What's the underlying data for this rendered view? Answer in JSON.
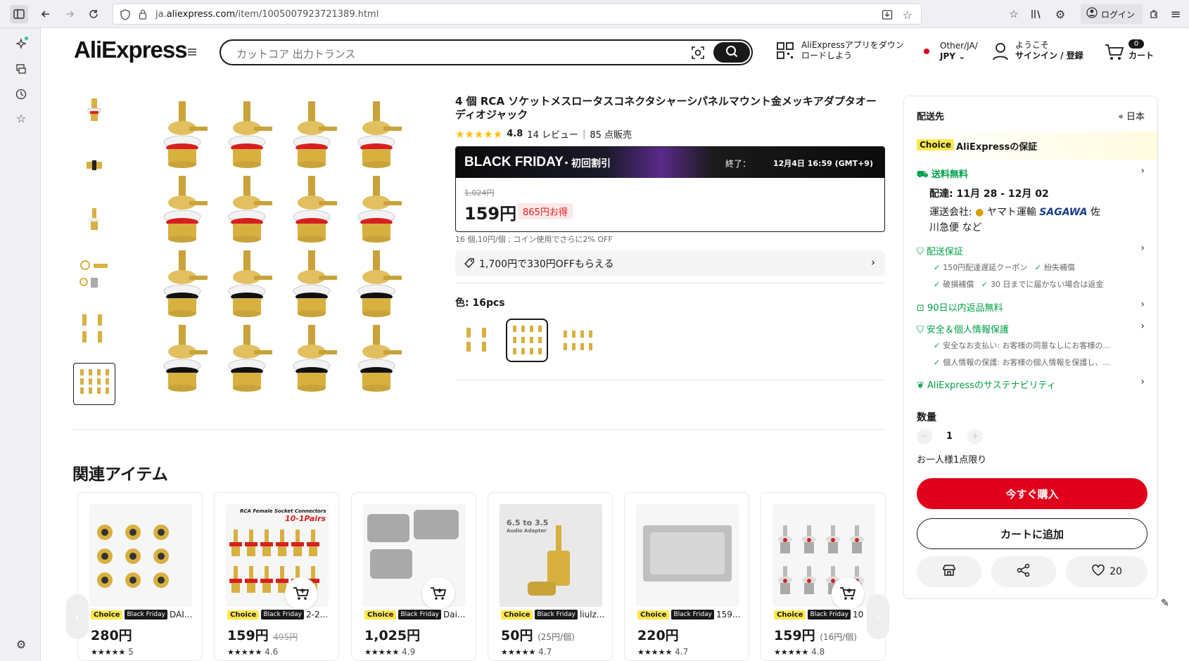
{
  "browser": {
    "url_prefix": "ja.",
    "url_domain": "aliexpress.com",
    "url_path": "/item/1005007923721389.html",
    "login_label": "ログイン"
  },
  "header": {
    "logo": "AliExpress",
    "search_placeholder": "カットコア 出力トランス",
    "app_line1": "AliExpressアプリをダウン",
    "app_line2": "ロードしよう",
    "region_line1": "Other/JA/",
    "region_line2": "JPY",
    "user_line1": "ようこそ",
    "user_line2": "サインイン / 登録",
    "cart_count": "0",
    "cart_label": "カート"
  },
  "product": {
    "title": "4 個 RCA ソケットメスロータスコネクタシャーシパネルマウント金メッキアダプタオーディオジャック",
    "rating": "4.8",
    "reviews": "14 レビュー",
    "sold": "85 点販売",
    "bf_title": "BLACK FRIDAY",
    "bf_sub": "・初回割引",
    "bf_end_label": "終了：",
    "bf_end_time": "12月4日 16:59 (GMT+9)",
    "price_old": "1,024円",
    "price": "159円",
    "save": "865円お得",
    "unit_note": "16 個,10円/個 ; コイン使用でさらに2% OFF",
    "coupon": "1,700円で330円OFFもらえる",
    "color_label": "色: 16pcs"
  },
  "panel": {
    "ship_to_label": "配送先",
    "ship_to_value": "日本",
    "choice_badge": "Choice",
    "guarantee": "AliExpressの保証",
    "free_shipping": "送料無料",
    "delivery": "配達: 11月 28 - 12月 02",
    "carrier_prefix": "運送会社:",
    "carrier1": "ヤマト運輸",
    "carrier2": "SAGAWA",
    "carrier_suffix": "佐",
    "carrier_line2": "川急便 など",
    "delivery_guarantee": "配送保証",
    "dg1": "150円配達遅延クーポン",
    "dg2": "紛失補償",
    "dg3": "破損補償",
    "dg4": "30 日までに届かない場合は返金",
    "returns": "90日以内返品無料",
    "safety": "安全＆個人情報保護",
    "safety1": "安全なお支払い: お客様の同意なしにお客様の...",
    "safety2": "個人情報の保護: お客様の個人情報を保護し、...",
    "sustain": "AliExpressのサステナビリティ",
    "qty_label": "数量",
    "qty_value": "1",
    "limit": "お一人様1点限り",
    "buy_now": "今すぐ購入",
    "add_cart": "カートに追加",
    "wishlist_count": "20"
  },
  "related": {
    "title": "関連アイテム",
    "items": [
      {
        "choice": "Choice",
        "bf": "Black Friday",
        "name": "DAI...",
        "price": "280円",
        "strike": "",
        "sub": "",
        "rating": "5"
      },
      {
        "choice": "Choice",
        "bf": "Black Friday",
        "name": "2-2...",
        "price": "159円",
        "strike": "495円",
        "sub": "",
        "rating": "4.6"
      },
      {
        "choice": "Choice",
        "bf": "Black Friday",
        "name": "Dai...",
        "price": "1,025円",
        "strike": "",
        "sub": "",
        "rating": "4.9"
      },
      {
        "choice": "Choice",
        "bf": "Black Friday",
        "name": "liulz...",
        "price": "50円",
        "strike": "",
        "sub": "(25円/個)",
        "rating": "4.7"
      },
      {
        "choice": "Choice",
        "bf": "Black Friday",
        "name": "159...",
        "price": "220円",
        "strike": "",
        "sub": "",
        "rating": "4.7"
      },
      {
        "choice": "Choice",
        "bf": "Black Friday",
        "name": "10 ...",
        "price": "159円",
        "strike": "",
        "sub": "(16円/個)",
        "rating": "4.8"
      }
    ],
    "img1_text": "RCA Female Socket Connectors",
    "img1_text2": "10-1Pairs",
    "img3_text": "6.5 to 3.5",
    "img3_text2": "Audio Adapter"
  },
  "colors": {
    "accent": "#e0001b",
    "choice": "#fde84f",
    "green": "#00a046",
    "star": "#fdbd07"
  }
}
